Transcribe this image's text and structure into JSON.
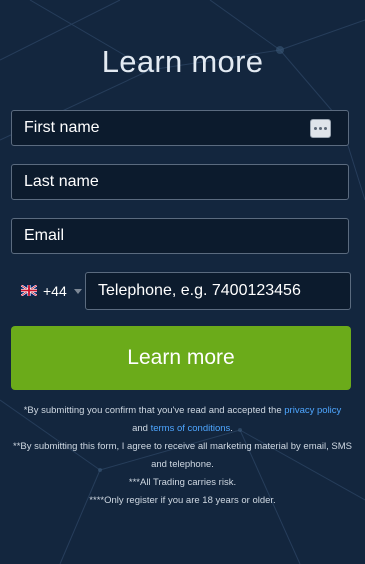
{
  "form": {
    "title": "Learn more",
    "first_name_placeholder": "First name",
    "last_name_placeholder": "Last name",
    "email_placeholder": "Email",
    "country_code": "+44",
    "country_flag": "uk-flag-icon",
    "telephone_placeholder": "Telephone, e.g. 7400123456",
    "submit_label": "Learn more",
    "autofill_icon": "more-dots-icon"
  },
  "disclaimer": {
    "line1_prefix": "*By submitting you confirm that you've read and accepted the ",
    "privacy_link": "privacy policy",
    "line1_and": "and ",
    "terms_link": "terms of conditions",
    "line1_end": ".",
    "line2": "**By submitting this form, I agree to receive all marketing material by email, SMS and telephone.",
    "line3": "***All Trading carries risk.",
    "line4": "****Only register if you are 18 years or older."
  },
  "colors": {
    "background": "#13263e",
    "accent_green": "#6bab1a",
    "link_blue": "#4ea6ff",
    "field_border": "#5b6b7f"
  }
}
